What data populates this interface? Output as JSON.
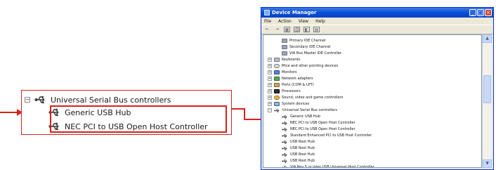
{
  "callout": {
    "parent_label": "Universal Serial Bus controllers",
    "expander": "−",
    "children": [
      "Generic USB Hub",
      "NEC PCI to USB Open Host Controller"
    ]
  },
  "window": {
    "title": "Device Manager",
    "controls": [
      "_",
      "□",
      "×"
    ],
    "menu": [
      "File",
      "Action",
      "View",
      "Help"
    ],
    "toolbar": [
      "←",
      "→",
      "▦",
      "🖨",
      "◧",
      "▤"
    ],
    "scroll": {
      "up": "▲",
      "down": "▼"
    }
  },
  "tree": [
    {
      "label": "Primary IDE Channel",
      "icon": "ide-channel-icon",
      "level": 2
    },
    {
      "label": "Secondary IDE Channel",
      "icon": "ide-channel-icon",
      "level": 2
    },
    {
      "label": "VIA Bus Master IDE Controller",
      "icon": "ide-channel-icon",
      "level": 2
    },
    {
      "label": "Keyboards",
      "icon": "keyboard-icon",
      "level": 1,
      "expander": "+"
    },
    {
      "label": "Mice and other pointing devices",
      "icon": "mouse-icon",
      "level": 1,
      "expander": "+"
    },
    {
      "label": "Monitors",
      "icon": "monitor-icon",
      "level": 1,
      "expander": "+"
    },
    {
      "label": "Network adapters",
      "icon": "network-icon",
      "level": 1,
      "expander": "+"
    },
    {
      "label": "Ports (COM & LPT)",
      "icon": "port-icon",
      "level": 1,
      "expander": "+"
    },
    {
      "label": "Processors",
      "icon": "processor-icon",
      "level": 1,
      "expander": "+"
    },
    {
      "label": "Sound, video and game controllers",
      "icon": "sound-icon",
      "level": 1,
      "expander": "+"
    },
    {
      "label": "System devices",
      "icon": "system-icon",
      "level": 1,
      "expander": "+"
    },
    {
      "label": "Universal Serial Bus controllers",
      "icon": "usb-icon",
      "level": 1,
      "expander": "−"
    },
    {
      "label": "Generic USB Hub",
      "icon": "usb-icon",
      "level": 2
    },
    {
      "label": "NEC PCI to USB Open Host Controller",
      "icon": "usb-icon",
      "level": 2
    },
    {
      "label": "NEC PCI to USB Open Host Controller",
      "icon": "usb-icon",
      "level": 2
    },
    {
      "label": "Standard Enhanced PCI to USB Host Controller",
      "icon": "usb-icon",
      "level": 2
    },
    {
      "label": "USB Root Hub",
      "icon": "usb-icon",
      "level": 2
    },
    {
      "label": "USB Root Hub",
      "icon": "usb-icon",
      "level": 2
    },
    {
      "label": "USB Root Hub",
      "icon": "usb-icon",
      "level": 2
    },
    {
      "label": "USB Root Hub",
      "icon": "usb-icon",
      "level": 2
    },
    {
      "label": "VIA Rev 5 or later USB Universal Host Controller",
      "icon": "usb-icon",
      "level": 2
    }
  ],
  "colors": {
    "callout_border": "#d8211d",
    "title_bar": "#0a4ed4"
  }
}
